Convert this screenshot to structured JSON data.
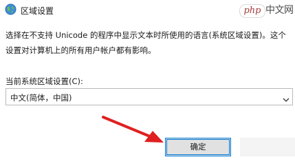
{
  "window": {
    "title": "区域设置",
    "title_icon": "region-globe-icon"
  },
  "watermark": {
    "badge": "php",
    "text": "中文网"
  },
  "main": {
    "description": "选择在不支持 Unicode 的程序中显示文本时所使用的语言(系统区域设置)。这个设置对计算机上的所有用户帐户都有影响。",
    "locale_label": "当前系统区域设置(C):",
    "locale_value": "中文(简体，中国)",
    "dropdown_icon": "chevron-down-icon"
  },
  "buttons": {
    "ok_label": "确定"
  },
  "annotation": {
    "arrow_icon": "red-arrow-icon",
    "arrow_color": "#e02020"
  },
  "colors": {
    "accent": "#0078d7",
    "button_bg": "#e1e1e1"
  }
}
